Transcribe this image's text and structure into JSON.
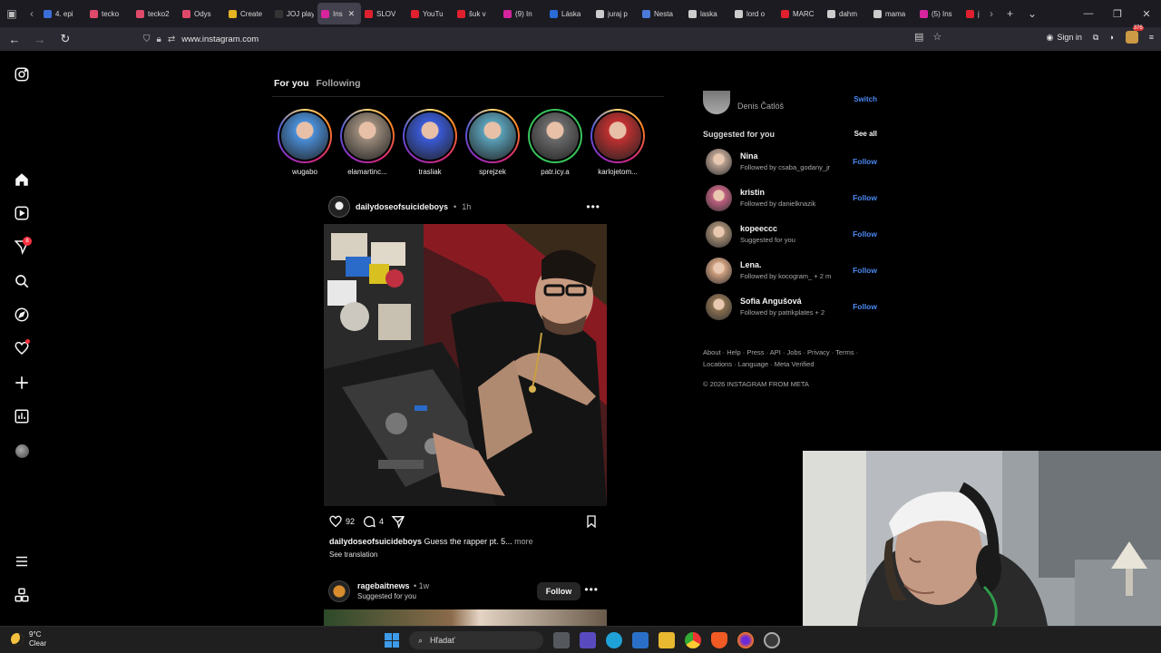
{
  "browser": {
    "tabs": [
      {
        "label": "4. epi",
        "color": "#3b6fd8"
      },
      {
        "label": "tecko",
        "color": "#e04a6a"
      },
      {
        "label": "tecko2",
        "color": "#e04a6a"
      },
      {
        "label": "Odys",
        "color": "#e04a6a"
      },
      {
        "label": "Create",
        "color": "#e6b422"
      },
      {
        "label": "JOJ play",
        "color": "#333333"
      },
      {
        "label": "Ins",
        "color": "#d6249f",
        "active": true
      },
      {
        "label": "SLOV",
        "color": "#e0202e"
      },
      {
        "label": "YouTu",
        "color": "#e0202e"
      },
      {
        "label": "šuk v",
        "color": "#e0202e"
      },
      {
        "label": "(9) In",
        "color": "#d6249f"
      },
      {
        "label": "Láska",
        "color": "#2a6bd8"
      },
      {
        "label": "juraj p",
        "color": "#cccccc"
      },
      {
        "label": "Nesta",
        "color": "#4a7ad8"
      },
      {
        "label": "laska",
        "color": "#cccccc"
      },
      {
        "label": "lord o",
        "color": "#cccccc"
      },
      {
        "label": "MARC",
        "color": "#e0202e"
      },
      {
        "label": "dahm",
        "color": "#cccccc"
      },
      {
        "label": "mama",
        "color": "#cccccc"
      },
      {
        "label": "(5) Ins",
        "color": "#d6249f"
      },
      {
        "label": "j",
        "color": "#e0202e"
      }
    ],
    "url": "www.instagram.com",
    "sign_in": "Sign in",
    "badge_count": "376"
  },
  "rail": {
    "notifications_count": "8"
  },
  "feed": {
    "tab_for_you": "For you",
    "tab_following": "Following",
    "stories": [
      {
        "name": "wugabo",
        "ring": "gradient",
        "color": "#4a8ed8"
      },
      {
        "name": "elamartinc...",
        "ring": "gradient",
        "color": "#9a8a7a"
      },
      {
        "name": "trasliak",
        "ring": "gradient",
        "color": "#3a5ad8"
      },
      {
        "name": "sprejzek",
        "ring": "gradient",
        "color": "#5aa0b8"
      },
      {
        "name": "patr.icy.a",
        "ring": "green",
        "color": "#6a6a6a"
      },
      {
        "name": "karlojetom...",
        "ring": "gradient",
        "color": "#c03030"
      }
    ],
    "post": {
      "username": "dailydoseofsuicideboys",
      "time": "1h",
      "likes": "92",
      "comments": "4",
      "caption_user": "dailydoseofsuicideboys",
      "caption_text": "Guess the rapper pt. 5...",
      "caption_more": "more",
      "see_translation": "See translation"
    },
    "post2": {
      "username": "ragebaitnews",
      "time": "1w",
      "subtitle": "Suggested for you",
      "follow": "Follow"
    }
  },
  "sidebar": {
    "me_name": "Denis Čatlóš",
    "switch": "Switch",
    "suggested_title": "Suggested for you",
    "see_all": "See all",
    "suggestions": [
      {
        "name": "Nina",
        "sub": "Followed by csaba_godany_jr",
        "follow": "Follow",
        "color": "#b8a090"
      },
      {
        "name": "kristin",
        "sub": "Followed by danielknazik",
        "follow": "Follow",
        "color": "#c06080"
      },
      {
        "name": "kopeeccc",
        "sub": "Suggested for you",
        "follow": "Follow",
        "color": "#a08870"
      },
      {
        "name": "Lena.",
        "sub": "Followed by kocogram_ + 2 m",
        "follow": "Follow",
        "color": "#d0a080"
      },
      {
        "name": "Sofia Angušová",
        "sub": "Followed by patrikplates + 2",
        "follow": "Follow",
        "color": "#8a7050"
      }
    ],
    "footer_links": "About · Help · Press · API · Jobs · Privacy · Terms · Locations · Language · Meta Verified",
    "copyright": "© 2026 INSTAGRAM FROM META"
  },
  "taskbar": {
    "temp": "9°C",
    "condition": "Clear",
    "search_placeholder": "Hľadať"
  },
  "colors": {
    "accent_link": "#4a88f0",
    "badge_red": "#ff3040"
  }
}
